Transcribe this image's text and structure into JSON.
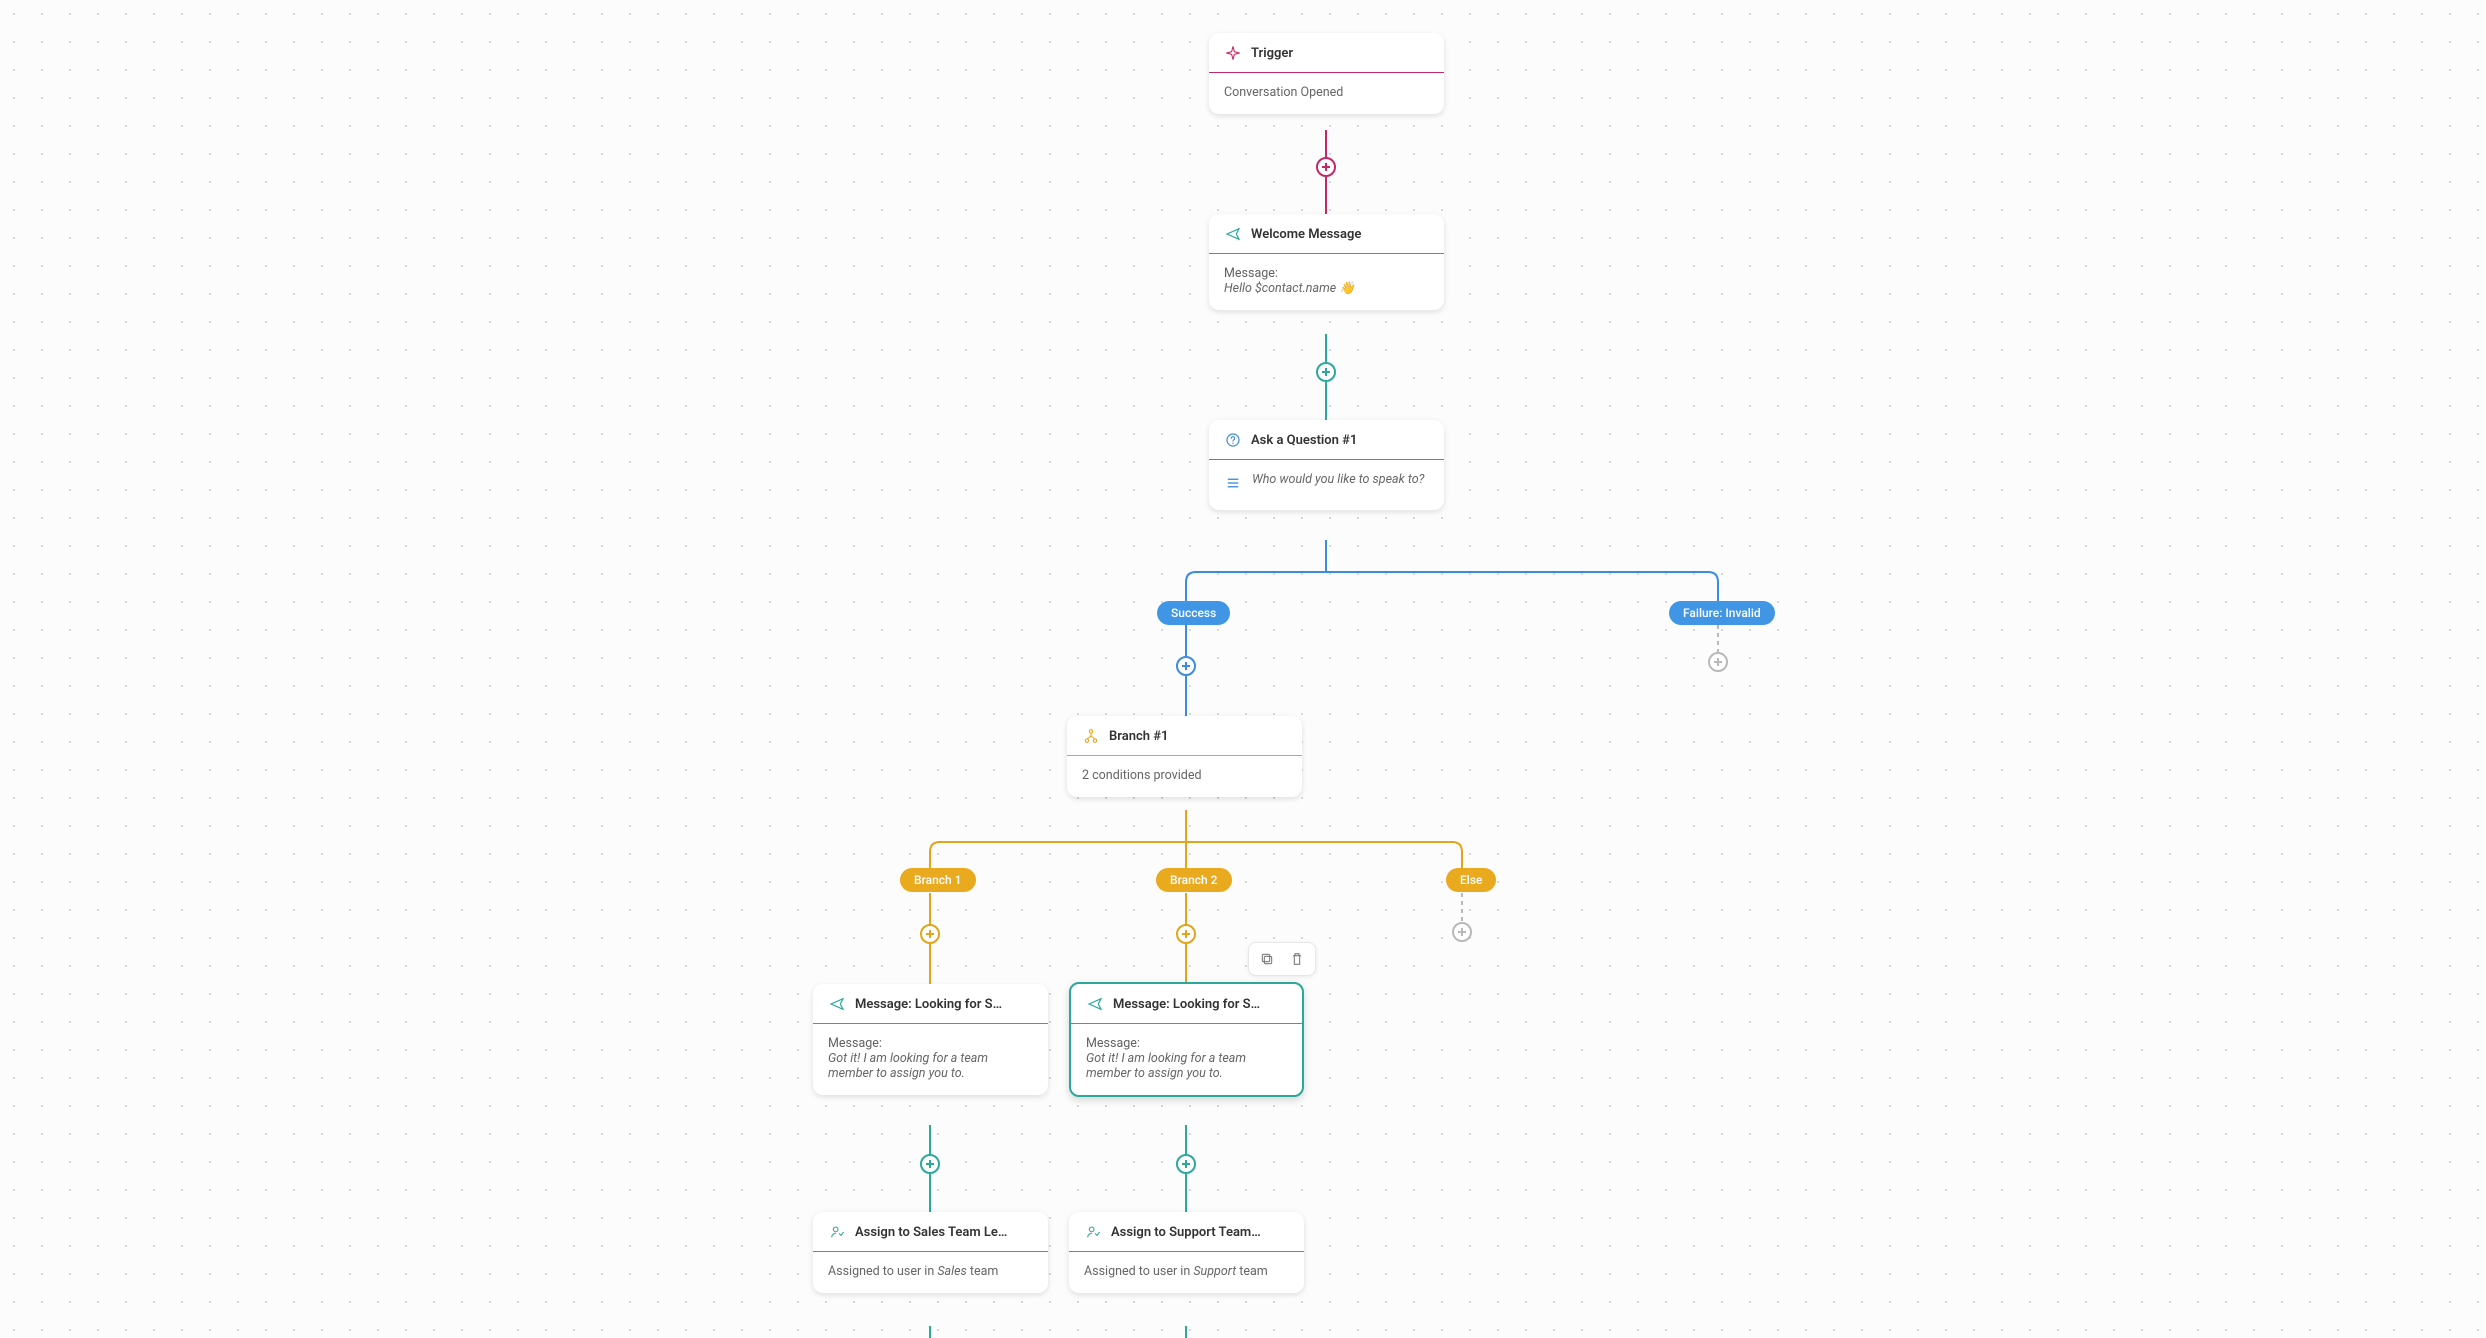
{
  "colors": {
    "magenta": "#c42766",
    "teal": "#2aa89a",
    "blue": "#3b8cde",
    "amber": "#e2a519",
    "gray": "#b9b9b9"
  },
  "trigger": {
    "title": "Trigger",
    "body": "Conversation Opened"
  },
  "welcome": {
    "title": "Welcome Message",
    "label": "Message:",
    "text": "Hello $contact.name 👋"
  },
  "question": {
    "title": "Ask a Question #1",
    "text": "Who would you like to speak to?"
  },
  "question_outcomes": {
    "success": "Success",
    "failure": "Failure: Invalid"
  },
  "branch": {
    "title": "Branch #1",
    "body": "2 conditions provided"
  },
  "branch_labels": {
    "b1": "Branch 1",
    "b2": "Branch 2",
    "else": "Else"
  },
  "msg_sales": {
    "title": "Message: Looking for S…",
    "label": "Message:",
    "text": "Got it! I am looking for a team member to assign you to."
  },
  "msg_support": {
    "title": "Message: Looking for S…",
    "label": "Message:",
    "text": "Got it! I am looking for a team member to assign you to."
  },
  "assign_sales": {
    "title": "Assign to Sales Team Le…",
    "prefix": "Assigned to user in ",
    "team": "Sales",
    "suffix": " team"
  },
  "assign_support": {
    "title": "Assign to Support Team…",
    "prefix": "Assigned to user in ",
    "team": "Support",
    "suffix": " team"
  }
}
